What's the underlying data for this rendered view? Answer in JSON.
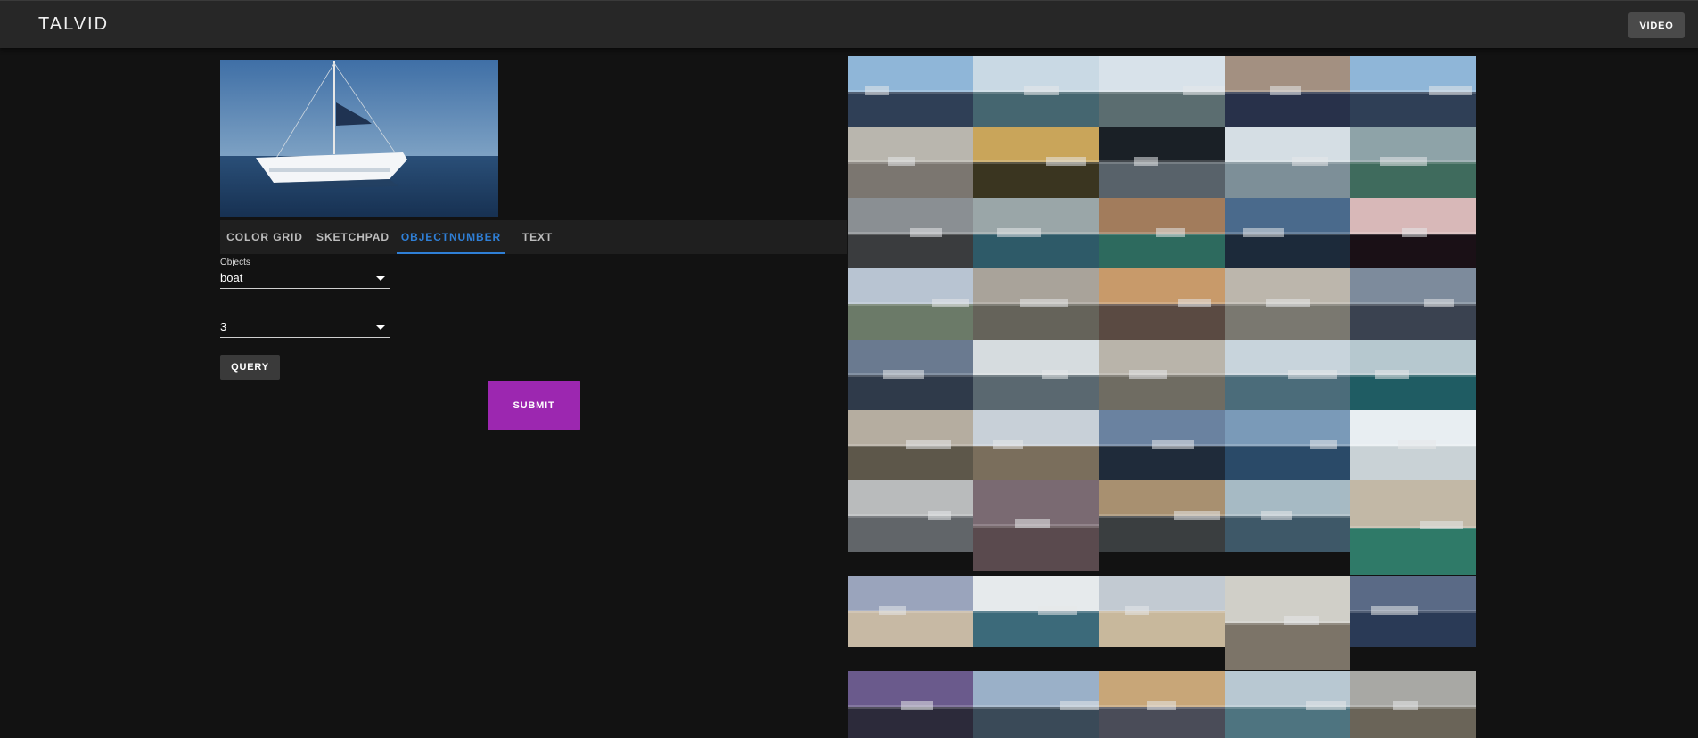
{
  "app": {
    "title": "TALVID",
    "video_button": "VIDEO"
  },
  "tabs": [
    {
      "label": "COLOR GRID",
      "active": false
    },
    {
      "label": "SKETCHPAD",
      "active": false
    },
    {
      "label": "OBJECTNUMBER",
      "active": true
    },
    {
      "label": "TEXT",
      "active": false
    }
  ],
  "object_form": {
    "objects_label": "Objects",
    "objects_value": "boat",
    "count_value": "3",
    "query_label": "QUERY",
    "submit_label": "SUBMIT"
  },
  "colors": {
    "accent_tab": "#2f7fd6",
    "submit": "#9c27b0",
    "appbar": "#272727",
    "background": "#121212"
  },
  "results": [
    {
      "scene": "marina-boats",
      "sky": "#8fb6d8",
      "ground": "#2f3f56"
    },
    {
      "scene": "harbor-yachts",
      "sky": "#c9d9e4",
      "ground": "#456670"
    },
    {
      "scene": "marina-deck",
      "sky": "#d8e2ea",
      "ground": "#5b6d70"
    },
    {
      "scene": "city-coast",
      "sky": "#a39081",
      "ground": "#28314a"
    },
    {
      "scene": "marina-boats",
      "sky": "#8fb6d8",
      "ground": "#2f3f56"
    },
    {
      "scene": "misty-bay",
      "sky": "#b9b6ae",
      "ground": "#7b7670"
    },
    {
      "scene": "sunset-pier",
      "sky": "#c9a55a",
      "ground": "#3a3520"
    },
    {
      "scene": "night-marina",
      "sky": "#1a2026",
      "ground": "#58626a"
    },
    {
      "scene": "white-harbor",
      "sky": "#d5dee4",
      "ground": "#7d8f98"
    },
    {
      "scene": "collage-coast",
      "sky": "#8ea3a8",
      "ground": "#3f6b5d"
    },
    {
      "scene": "rainy-dock",
      "sky": "#8a8f93",
      "ground": "#3a3c3e"
    },
    {
      "scene": "fishing-boats",
      "sky": "#9aa6a8",
      "ground": "#2e5a68"
    },
    {
      "scene": "cliff-water",
      "sky": "#a27c5c",
      "ground": "#2d6a5e"
    },
    {
      "scene": "boat-deck",
      "sky": "#4a6a8c",
      "ground": "#1c2a3a"
    },
    {
      "scene": "dark-cabin",
      "sky": "#d8b8b8",
      "ground": "#1a1016"
    },
    {
      "scene": "white-town",
      "sky": "#b8c4d2",
      "ground": "#6b7a68"
    },
    {
      "scene": "gray-sea",
      "sky": "#a9a39a",
      "ground": "#65635a"
    },
    {
      "scene": "sunset-sea",
      "sky": "#c89a6a",
      "ground": "#5a4a42"
    },
    {
      "scene": "hazy-port",
      "sky": "#bcb6ac",
      "ground": "#7a7870"
    },
    {
      "scene": "cathedral",
      "sky": "#7d8b9c",
      "ground": "#3a4250"
    },
    {
      "scene": "people-wine",
      "sky": "#6a7a90",
      "ground": "#2f3a4a"
    },
    {
      "scene": "port-caption",
      "sky": "#d6dcdf",
      "ground": "#5a6870"
    },
    {
      "scene": "gray-port",
      "sky": "#b9b4aa",
      "ground": "#6f6c62"
    },
    {
      "scene": "mountain-lake",
      "sky": "#c8d4dc",
      "ground": "#4b6c7a"
    },
    {
      "scene": "glacier",
      "sky": "#b6c8cf",
      "ground": "#1f5c63"
    },
    {
      "scene": "canal-city",
      "sky": "#b5ada0",
      "ground": "#5d574a"
    },
    {
      "scene": "quay-walk",
      "sky": "#c8d0d8",
      "ground": "#7a6e5c"
    },
    {
      "scene": "marina-aerial",
      "sky": "#6a82a0",
      "ground": "#1f2b3a"
    },
    {
      "scene": "blue-lake",
      "sky": "#7a9ab8",
      "ground": "#2a4a68"
    },
    {
      "scene": "couple",
      "sky": "#e8eef2",
      "ground": "#c9d2d6"
    },
    {
      "scene": "ferry",
      "sky": "#b9bbbc",
      "ground": "#616569"
    },
    {
      "scene": "canopy",
      "sky": "#7a6a72",
      "ground": "#5a4a4e"
    },
    {
      "scene": "tall-ship",
      "sky": "#a89070",
      "ground": "#3a3e40"
    },
    {
      "scene": "sunny-sea",
      "sky": "#a6bac4",
      "ground": "#3e5868"
    },
    {
      "scene": "rock-wall",
      "sky": "#c2b8a6",
      "ground": "#2f7a68"
    },
    {
      "scene": "beach-people",
      "sky": "#9aa4bc",
      "ground": "#c7b9a4"
    },
    {
      "scene": "red-ferry",
      "sky": "#e6eaec",
      "ground": "#3c6a7a"
    },
    {
      "scene": "kite-beach",
      "sky": "#c2cad2",
      "ground": "#c8b89c"
    },
    {
      "scene": "paddle-steamer",
      "sky": "#d0cfc8",
      "ground": "#7c7468"
    },
    {
      "scene": "rock-picnic",
      "sky": "#5a6a86",
      "ground": "#2a3a56"
    },
    {
      "scene": "dusk-boat",
      "sky": "#6a5a8c",
      "ground": "#2c2a3a"
    },
    {
      "scene": "harbor-dog",
      "sky": "#9ab0c8",
      "ground": "#3a4a58"
    },
    {
      "scene": "pier-sunset",
      "sky": "#c8a678",
      "ground": "#4a4c58"
    },
    {
      "scene": "bridge-lake",
      "sky": "#b8c8d2",
      "ground": "#4e7480"
    },
    {
      "scene": "boat-hill",
      "sky": "#a8a8a4",
      "ground": "#6a6458"
    }
  ]
}
